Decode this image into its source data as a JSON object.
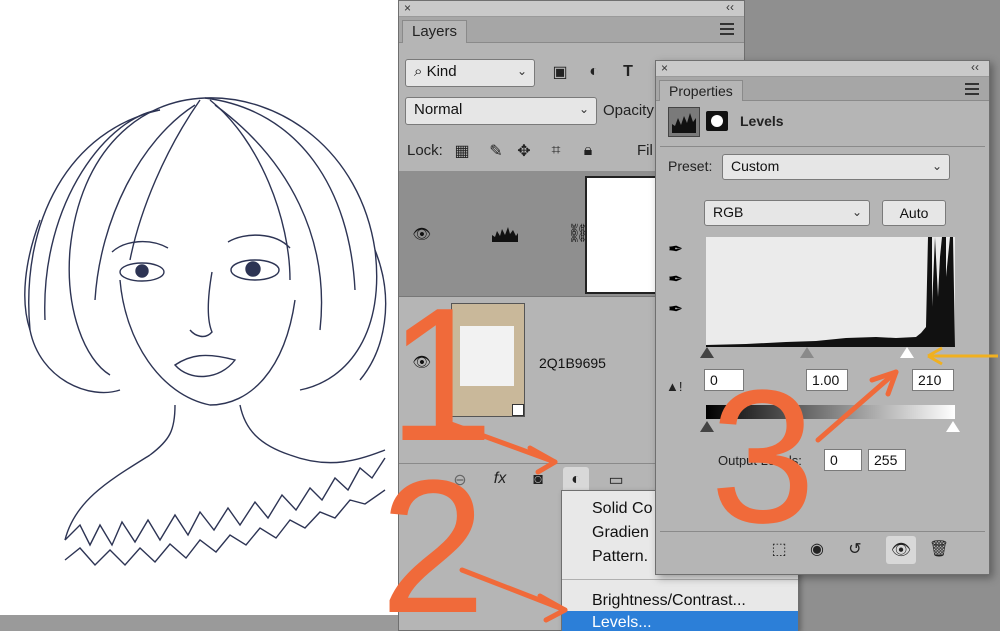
{
  "layers_panel": {
    "tab_label": "Layers",
    "filter_kind": "Kind",
    "blend_mode": "Normal",
    "opacity_label": "Opacity",
    "lock_label": "Lock:",
    "fill_label": "Fil",
    "layers": [
      {
        "name": ""
      },
      {
        "name": "2Q1B9695"
      }
    ]
  },
  "adjustment_menu": {
    "items_top": [
      "Solid Co",
      "Gradien",
      "Pattern."
    ],
    "items_bottom": [
      "Brightness/Contrast...",
      "Levels..."
    ],
    "selected": "Levels..."
  },
  "properties_panel": {
    "tab_label": "Properties",
    "adjustment_title": "Levels",
    "preset_label": "Preset:",
    "preset_value": "Custom",
    "channel_value": "RGB",
    "auto_label": "Auto",
    "input_black": "0",
    "input_mid": "1.00",
    "input_white": "210",
    "output_label": "Output Levels:",
    "output_black": "0",
    "output_white": "255"
  },
  "annotations": {
    "step_1": "1",
    "step_2": "2",
    "step_3": "3",
    "arrow_color": "#f06a3a",
    "yellow_arrow_color": "#f0b020"
  }
}
